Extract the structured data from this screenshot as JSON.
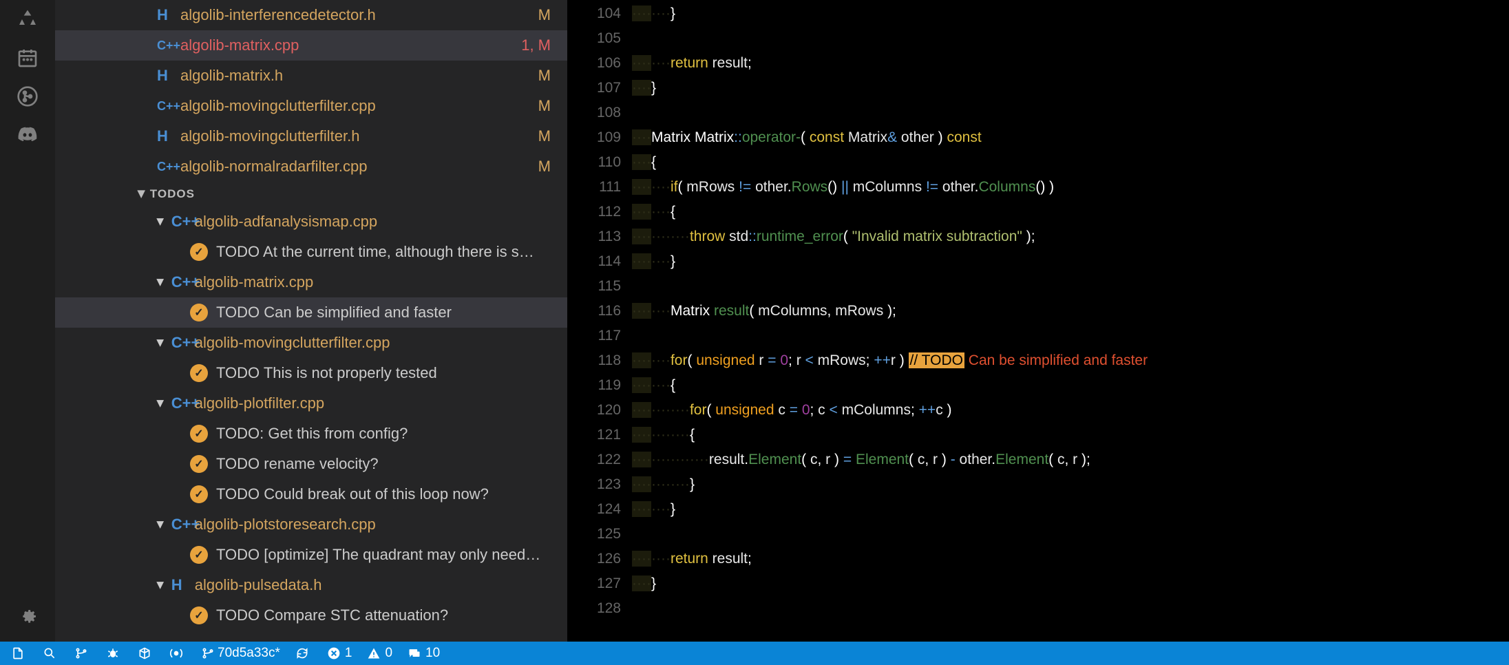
{
  "activityIcons": [
    "tree",
    "calendar",
    "git",
    "discord",
    "gear"
  ],
  "files": [
    {
      "icon": "h",
      "name": "algolib-interferencedetector.h",
      "status": "M",
      "err": false
    },
    {
      "icon": "cpp",
      "name": "algolib-matrix.cpp",
      "status": "1, M",
      "err": true,
      "sel": true
    },
    {
      "icon": "h",
      "name": "algolib-matrix.h",
      "status": "M",
      "err": false
    },
    {
      "icon": "cpp",
      "name": "algolib-movingclutterfilter.cpp",
      "status": "M",
      "err": false
    },
    {
      "icon": "h",
      "name": "algolib-movingclutterfilter.h",
      "status": "M",
      "err": false
    },
    {
      "icon": "cpp",
      "name": "algolib-normalradarfilter.cpp",
      "status": "M",
      "err": false
    }
  ],
  "todoSection": "TODOS",
  "todoGroups": [
    {
      "icon": "cpp",
      "file": "algolib-adfanalysismap.cpp",
      "items": [
        {
          "t": "TODO At the current time, although there is s…"
        }
      ]
    },
    {
      "icon": "cpp",
      "file": "algolib-matrix.cpp",
      "items": [
        {
          "t": "TODO Can be simplified and faster",
          "sel": true
        }
      ]
    },
    {
      "icon": "cpp",
      "file": "algolib-movingclutterfilter.cpp",
      "items": [
        {
          "t": "TODO This is not properly tested"
        }
      ]
    },
    {
      "icon": "cpp",
      "file": "algolib-plotfilter.cpp",
      "items": [
        {
          "t": "TODO: Get this from config?"
        },
        {
          "t": "TODO rename velocity?"
        },
        {
          "t": "TODO Could break out of this loop now?"
        }
      ]
    },
    {
      "icon": "cpp",
      "file": "algolib-plotstoresearch.cpp",
      "items": [
        {
          "t": "TODO [optimize] The quadrant may only need…"
        }
      ]
    },
    {
      "icon": "h",
      "file": "algolib-pulsedata.h",
      "items": [
        {
          "t": "TODO Compare STC attenuation?"
        }
      ]
    }
  ],
  "codeStart": 104,
  "code": [
    [
      {
        "ws": 8
      },
      {
        "p": "}"
      }
    ],
    [],
    [
      {
        "ws": 8
      },
      {
        "k": "return"
      },
      {
        "t": " result"
      },
      {
        "p": ";"
      }
    ],
    [
      {
        "ws": 4
      },
      {
        "p": "}"
      }
    ],
    [],
    [
      {
        "ws": 4
      },
      {
        "ty": "Matrix "
      },
      {
        "ty": "Matrix"
      },
      {
        "op": "::"
      },
      {
        "fn": "operator-"
      },
      {
        "p": "( "
      },
      {
        "k": "const"
      },
      {
        "t": " Matrix"
      },
      {
        "op": "&"
      },
      {
        "t": " other "
      },
      {
        "p": ")"
      },
      {
        "t": " "
      },
      {
        "k": "const"
      }
    ],
    [
      {
        "ws": 4
      },
      {
        "p": "{"
      }
    ],
    [
      {
        "ws": 8
      },
      {
        "k": "if"
      },
      {
        "p": "("
      },
      {
        "t": " mRows "
      },
      {
        "op": "!="
      },
      {
        "t": " other"
      },
      {
        "p": "."
      },
      {
        "fn": "Rows"
      },
      {
        "p": "() "
      },
      {
        "op": "||"
      },
      {
        "t": " mColumns "
      },
      {
        "op": "!="
      },
      {
        "t": " other"
      },
      {
        "p": "."
      },
      {
        "fn": "Columns"
      },
      {
        "p": "() )"
      }
    ],
    [
      {
        "ws": 8
      },
      {
        "p": "{"
      }
    ],
    [
      {
        "ws": 12
      },
      {
        "k": "throw"
      },
      {
        "t": " std"
      },
      {
        "op": "::"
      },
      {
        "fn": "runtime_error"
      },
      {
        "p": "( "
      },
      {
        "s": "\"Invalid matrix subtraction\""
      },
      {
        "p": " );"
      }
    ],
    [
      {
        "ws": 8
      },
      {
        "p": "}"
      }
    ],
    [],
    [
      {
        "ws": 8
      },
      {
        "ty": "Matrix "
      },
      {
        "fn": "result"
      },
      {
        "p": "("
      },
      {
        "t": " mColumns"
      },
      {
        "p": ","
      },
      {
        "t": " mRows "
      },
      {
        "p": ");"
      }
    ],
    [],
    [
      {
        "ws": 8
      },
      {
        "k": "for"
      },
      {
        "p": "( "
      },
      {
        "k2": "unsigned"
      },
      {
        "t": " r "
      },
      {
        "op": "="
      },
      {
        "t": " "
      },
      {
        "n": "0"
      },
      {
        "p": ";"
      },
      {
        "t": " r "
      },
      {
        "op": "<"
      },
      {
        "t": " mRows"
      },
      {
        "p": ";"
      },
      {
        "t": " "
      },
      {
        "op": "++"
      },
      {
        "t": "r "
      },
      {
        "p": ")"
      },
      {
        "t": " "
      },
      {
        "todo": "// TODO"
      },
      {
        "todot": " Can be simplified and faster"
      }
    ],
    [
      {
        "ws": 8
      },
      {
        "p": "{"
      }
    ],
    [
      {
        "ws": 12
      },
      {
        "k": "for"
      },
      {
        "p": "( "
      },
      {
        "k2": "unsigned"
      },
      {
        "t": " c "
      },
      {
        "op": "="
      },
      {
        "t": " "
      },
      {
        "n": "0"
      },
      {
        "p": ";"
      },
      {
        "t": " c "
      },
      {
        "op": "<"
      },
      {
        "t": " mColumns"
      },
      {
        "p": ";"
      },
      {
        "t": " "
      },
      {
        "op": "++"
      },
      {
        "t": "c "
      },
      {
        "p": ")"
      }
    ],
    [
      {
        "ws": 12
      },
      {
        "p": "{"
      }
    ],
    [
      {
        "ws": 16
      },
      {
        "t": "result"
      },
      {
        "p": "."
      },
      {
        "fn": "Element"
      },
      {
        "p": "("
      },
      {
        "t": " c"
      },
      {
        "p": ","
      },
      {
        "t": " r "
      },
      {
        "p": ")"
      },
      {
        "t": " "
      },
      {
        "op": "="
      },
      {
        "t": " "
      },
      {
        "fn": "Element"
      },
      {
        "p": "("
      },
      {
        "t": " c"
      },
      {
        "p": ","
      },
      {
        "t": " r "
      },
      {
        "p": ")"
      },
      {
        "t": " "
      },
      {
        "op": "-"
      },
      {
        "t": " other"
      },
      {
        "p": "."
      },
      {
        "fn": "Element"
      },
      {
        "p": "("
      },
      {
        "t": " c"
      },
      {
        "p": ","
      },
      {
        "t": " r "
      },
      {
        "p": ");"
      }
    ],
    [
      {
        "ws": 12
      },
      {
        "p": "}"
      }
    ],
    [
      {
        "ws": 8
      },
      {
        "p": "}"
      }
    ],
    [],
    [
      {
        "ws": 8
      },
      {
        "k": "return"
      },
      {
        "t": " result"
      },
      {
        "p": ";"
      }
    ],
    [
      {
        "ws": 4
      },
      {
        "p": "}"
      }
    ],
    []
  ],
  "status": {
    "branch": "70d5a33c*",
    "errors": "1",
    "warnings": "0",
    "comments": "10"
  }
}
